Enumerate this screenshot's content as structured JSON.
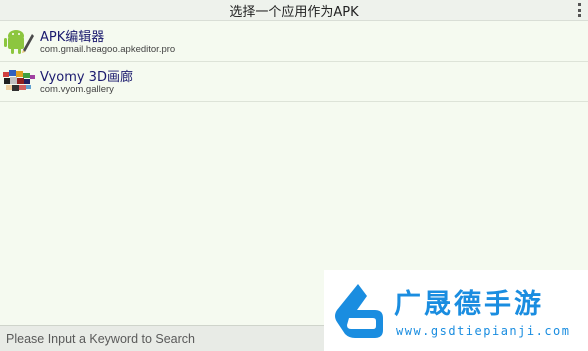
{
  "header": {
    "title": "选择一个应用作为APK",
    "menu_icon": "overflow-menu-icon"
  },
  "apps": [
    {
      "name": "APK编辑器",
      "package": "com.gmail.heagoo.apkeditor.pro",
      "icon": "android-pencil-icon"
    },
    {
      "name": "Vyomy 3D画廊",
      "package": "com.vyom.gallery",
      "icon": "gallery-icon"
    }
  ],
  "search": {
    "placeholder": "Please Input a Keyword to Search",
    "value": ""
  },
  "watermark": {
    "text": "广晟德手游",
    "url": "www.gsdtiepianji.com"
  },
  "colors": {
    "background": "#f5faf0",
    "app_name": "#1a1a6e",
    "watermark_blue": "#1a8de0"
  }
}
